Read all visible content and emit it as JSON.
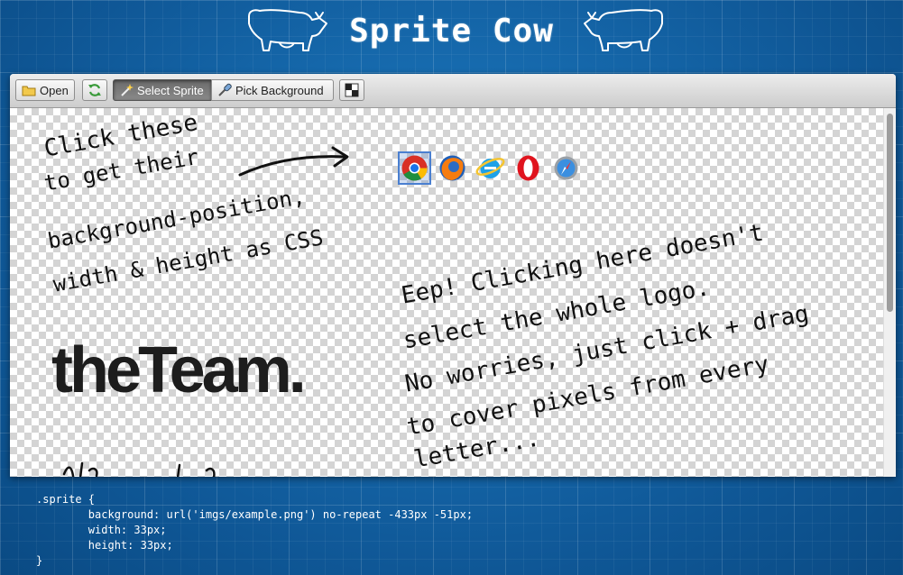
{
  "app": {
    "title": "Sprite Cow"
  },
  "toolbar": {
    "open_label": "Open",
    "reload_label": "",
    "select_sprite_label": "Select Sprite",
    "pick_background_label": "Pick Background",
    "select_sprite_active": true
  },
  "canvas": {
    "note_1": [
      "Click these",
      "to get their",
      "background-position,",
      "width & height as CSS"
    ],
    "note_2": [
      "Eep! Clicking here doesn't",
      "select the whole logo.",
      "No worries, just click + drag",
      "to cover pixels from every",
      "letter..."
    ],
    "logo_text": "theTeam.",
    "browser_icons": [
      "chrome-icon",
      "firefox-icon",
      "ie-icon",
      "opera-icon",
      "safari-icon"
    ],
    "selected_icon": "chrome-icon"
  },
  "css_output": {
    "line_1": ".sprite {",
    "line_2": "        background: url('imgs/example.png') no-repeat -433px -51px;",
    "line_3": "        width: 33px;",
    "line_4": "        height: 33px;",
    "line_5": "}"
  },
  "colors": {
    "background": "#1565a8",
    "accent_selection": "#4a7fd0"
  }
}
